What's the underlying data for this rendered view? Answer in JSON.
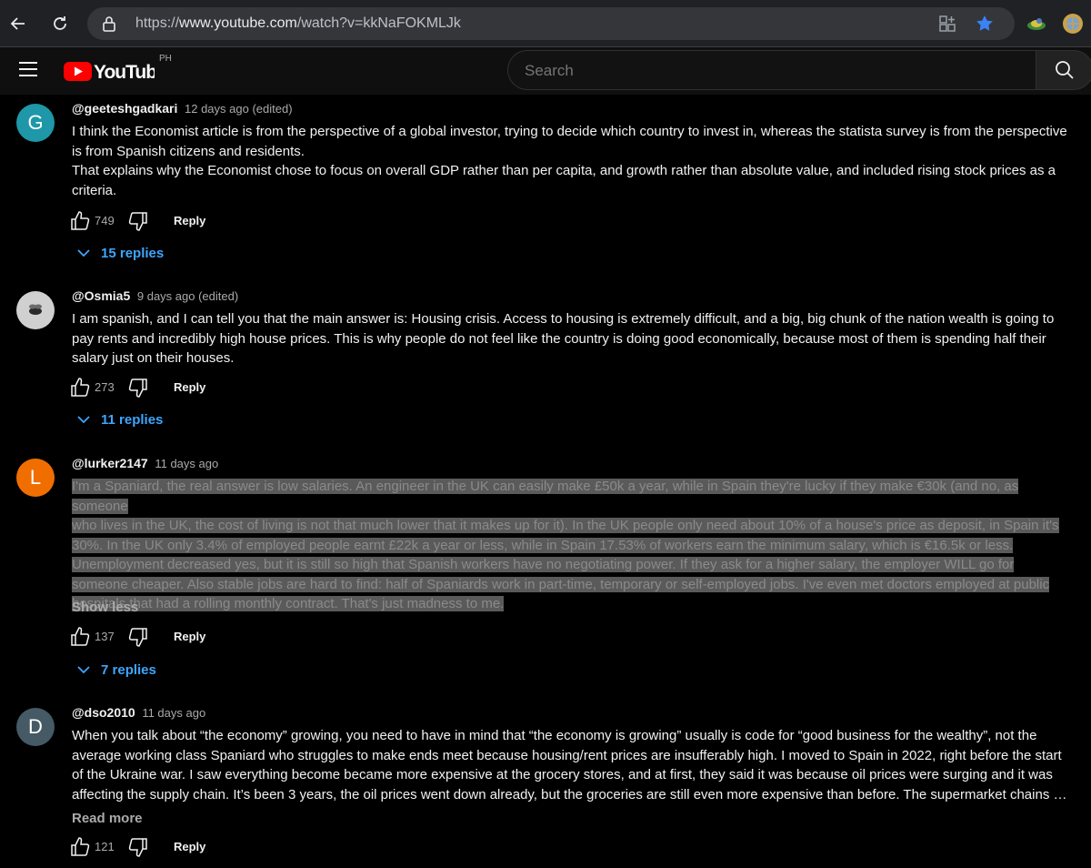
{
  "browser": {
    "url_prefix": "https://",
    "url_host": "www.youtube.com",
    "url_path": "/watch?v=kkNaFOKMLJk"
  },
  "masthead": {
    "logo_text": "YouTube",
    "region": "PH",
    "search_placeholder": "Search"
  },
  "comments": [
    {
      "author": "@geeteshgadkari",
      "time": "12 days ago (edited)",
      "avatar_letter": "G",
      "avatar_color": "#1e97a8",
      "paragraphs": [
        "I think the Economist article is from the perspective of a global investor, trying to decide which country to invest in, whereas the statista survey is from the perspective is from Spanish citizens and residents.",
        "That explains why the Economist chose to focus on overall GDP rather than per capita, and growth rather than absolute value, and included rising stock prices as a criteria."
      ],
      "likes": "749",
      "reply_label": "Reply",
      "replies_label": "15 replies"
    },
    {
      "author": "@Osmia5",
      "time": "9 days ago (edited)",
      "avatar_letter": "",
      "avatar_color": "#d0d0d0",
      "paragraphs": [
        "I am spanish, and I can tell you that the main answer is: Housing crisis. Access to housing is extremely difficult, and a big, big chunk of the nation wealth is going to pay rents and incredibly high house prices. This is why people do not feel like the country is doing good economically, because most of them is spending half their salary just on their houses."
      ],
      "likes": "273",
      "reply_label": "Reply",
      "replies_label": "11 replies"
    },
    {
      "author": "@lurker2147",
      "time": "11 days ago",
      "avatar_letter": "L",
      "avatar_color": "#f06e00",
      "selected_lines": [
        "I'm a Spaniard, the real answer is low salaries. An engineer in the UK can easily make £50k a year, while in Spain they're lucky if they make €30k (and no, as someone",
        "who lives in the UK, the cost of living is not that much lower that it makes up for it). In the UK people only need about 10% of a house's price as deposit, in Spain it's",
        "30%. In the UK only 3.4% of employed people earnt £22k a year or less, while in Spain 17.53% of workers earn the minimum salary, which is €16.5k or less.",
        "Unemployment decreased yes, but it is still so high that Spanish workers have no negotiating power. If they ask for a higher salary, the employer WILL go for",
        "someone cheaper. Also stable jobs are hard to find: half of Spaniards work in part-time, temporary or self-employed jobs. I've even met doctors employed at public",
        "hospitals that had a rolling monthly contract. That's just madness to me."
      ],
      "toggle_label": "Show less",
      "likes": "137",
      "reply_label": "Reply",
      "replies_label": "7 replies"
    },
    {
      "author": "@dso2010",
      "time": "11 days ago",
      "avatar_letter": "D",
      "avatar_color": "#455a64",
      "paragraphs": [
        "When you talk about “the economy” growing, you need to have in mind that “the economy is growing” usually is code for “good business for the wealthy”, not the average working class Spaniard who struggles to make ends meet because housing/rent prices are insufferably high. I moved to Spain in 2022, right before the start of the Ukraine war. I saw everything become became more expensive at the grocery stores, and at first, they said it was because oil prices were surging and it was affecting the supply chain. It’s been 3 years, the oil prices went down already, but the groceries are still even more expensive than before. The supermarket chains …"
      ],
      "toggle_label": "Read more",
      "likes": "121",
      "reply_label": "Reply"
    }
  ]
}
